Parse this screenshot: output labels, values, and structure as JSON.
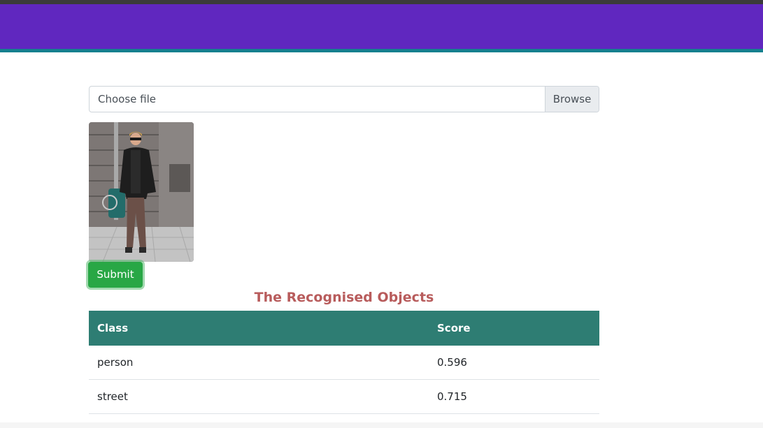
{
  "upload": {
    "placeholder": "Choose file",
    "browse_label": "Browse"
  },
  "submit_label": "Submit",
  "results": {
    "title": "The Recognised Objects",
    "columns": [
      "Class",
      "Score"
    ],
    "rows": [
      {
        "class": "person",
        "score": "0.596"
      },
      {
        "class": "street",
        "score": "0.715"
      }
    ]
  },
  "colors": {
    "navbar": "#6027bf",
    "navbar_accent": "#16808e",
    "submit": "#28a745",
    "table_header": "#2e7d73",
    "title": "#b85c5c"
  }
}
